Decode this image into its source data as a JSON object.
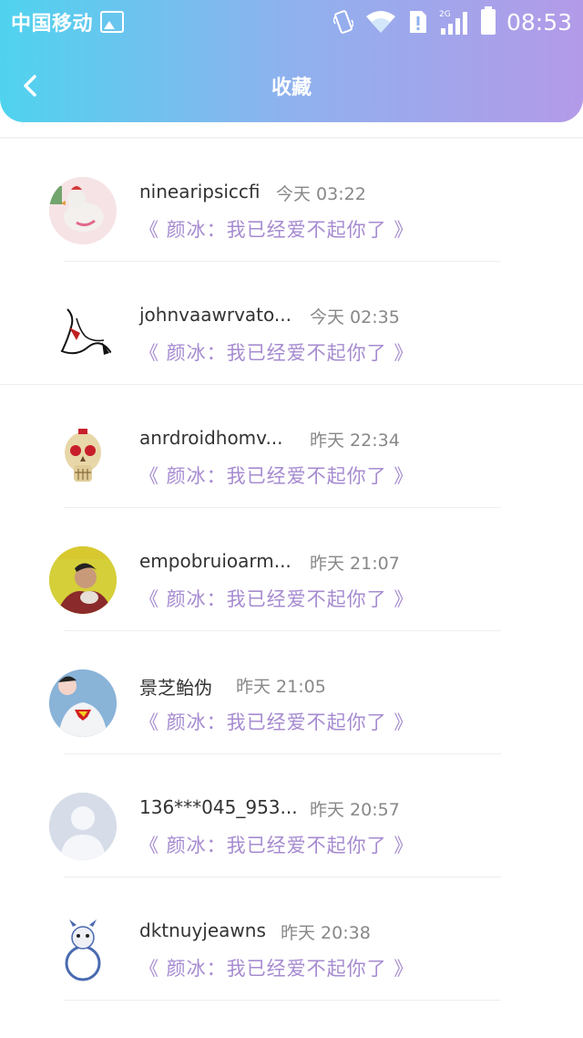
{
  "status_bar": {
    "carrier": "中国移动",
    "network": "2G",
    "time": "08:53"
  },
  "nav": {
    "title": "收藏"
  },
  "items": [
    {
      "name": "ninearipsiccfi",
      "time": "今天 03:22",
      "quote": "《 颜冰：我已经爱不起你了 》",
      "avatar_color": "#f6e3e6"
    },
    {
      "name": "johnvaawrvato...",
      "time": "今天 02:35",
      "quote": "《 颜冰：我已经爱不起你了 》",
      "avatar_color": "#ffffff"
    },
    {
      "name": "anrdroidhomv...",
      "time": "昨天 22:34",
      "quote": "《 颜冰：我已经爱不起你了 》",
      "avatar_color": "#ffffff"
    },
    {
      "name": "empobruioarm...",
      "time": "昨天 21:07",
      "quote": "《 颜冰：我已经爱不起你了 》",
      "avatar_color": "#d5cf3a"
    },
    {
      "name": "景芝鲐伪",
      "time": "昨天 21:05",
      "quote": "《 颜冰：我已经爱不起你了 》",
      "avatar_color": "#8ab3d8"
    },
    {
      "name": "136***045_953...",
      "time": "昨天 20:57",
      "quote": "《 颜冰：我已经爱不起你了 》",
      "avatar_color": "#d6dce8"
    },
    {
      "name": "dktnuyjeawns",
      "time": "昨天 20:38",
      "quote": "《 颜冰：我已经爱不起你了 》",
      "avatar_color": "#ffffff"
    }
  ],
  "colors": {
    "accent_quote": "#a68bd0",
    "header_gradient_start": "#4fd3ee",
    "header_gradient_end": "#b39ae8"
  }
}
